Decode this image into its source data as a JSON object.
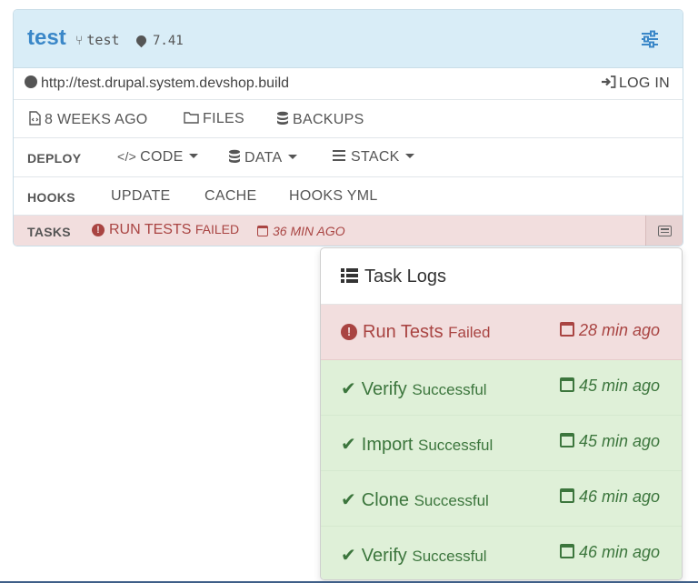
{
  "environment": {
    "name": "test",
    "branch": "test",
    "version": "7.41",
    "settings_icon": "sliders-icon"
  },
  "url_row": {
    "url": "http://test.drupal.system.devshop.build",
    "login_label": "LOG IN"
  },
  "meta_row": {
    "last_deploy": "8 WEEKS AGO",
    "files_label": "FILES",
    "backups_label": "BACKUPS"
  },
  "deploy_row": {
    "label": "DEPLOY",
    "code_label": "CODE",
    "data_label": "DATA",
    "stack_label": "STACK"
  },
  "hooks_row": {
    "label": "HOOKS",
    "items": [
      "UPDATE",
      "CACHE",
      "HOOKS YML"
    ]
  },
  "tasks_row": {
    "label": "TASKS",
    "task_name": "RUN TESTS",
    "task_status": "FAILED",
    "task_time": "36 MIN AGO"
  },
  "task_logs": {
    "title": "Task Logs",
    "items": [
      {
        "name": "Run Tests",
        "status": "Failed",
        "time": "28 min ago",
        "state": "fail"
      },
      {
        "name": "Verify",
        "status": "Successful",
        "time": "45 min ago",
        "state": "ok"
      },
      {
        "name": "Import",
        "status": "Successful",
        "time": "45 min ago",
        "state": "ok"
      },
      {
        "name": "Clone",
        "status": "Successful",
        "time": "46 min ago",
        "state": "ok"
      },
      {
        "name": "Verify",
        "status": "Successful",
        "time": "46 min ago",
        "state": "ok"
      }
    ]
  },
  "colors": {
    "header_bg": "#d9edf7",
    "brand_blue": "#3a87c8",
    "danger_bg": "#f2dede",
    "danger_text": "#a94442",
    "success_bg": "#dff0d8",
    "success_text": "#3c763d"
  }
}
